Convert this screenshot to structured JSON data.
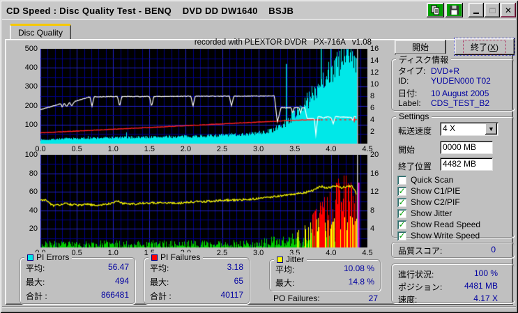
{
  "window": {
    "title": "CD Speed : Disc Quality Test - BENQ    DVD DD DW1640    BSJB"
  },
  "titlebar": {
    "copy": "copy",
    "save": "save",
    "minimize": "minimize",
    "maximize": "maximize",
    "close": "close"
  },
  "tab": {
    "label": "Disc Quality"
  },
  "chart_header": "recorded with PLEXTOR DVDR   PX-716A   v1.08",
  "actions": {
    "start_label": "開始",
    "exit_pre": "終了(",
    "exit_key": "X",
    "exit_post": ")"
  },
  "disc_info": {
    "title": "ディスク情報",
    "rows": [
      {
        "label": "タイプ:",
        "value": "DVD+R"
      },
      {
        "label": "ID:",
        "value": "YUDEN000 T02"
      },
      {
        "label": "日付:",
        "value": "10 August 2005"
      },
      {
        "label": "Label:",
        "value": "CDS_TEST_B2"
      }
    ]
  },
  "settings": {
    "title": "Settings",
    "speed_label": "転送速度",
    "speed_value": "4 X",
    "start_label": "開始",
    "start_value": "0000 MB",
    "end_label": "終了位置",
    "end_value": "4482 MB",
    "checkboxes": [
      {
        "label": "Quick Scan",
        "checked": false
      },
      {
        "label": "Show C1/PIE",
        "checked": true
      },
      {
        "label": "Show C2/PIF",
        "checked": true
      },
      {
        "label": "Show Jitter",
        "checked": true
      },
      {
        "label": "Show Read Speed",
        "checked": true
      },
      {
        "label": "Show Write Speed",
        "checked": true
      }
    ]
  },
  "score": {
    "label": "品質スコア:",
    "value": "0"
  },
  "progress": {
    "rows": [
      {
        "label": "進行状況:",
        "value": "100 %"
      },
      {
        "label": "ポジション:",
        "value": "4481 MB"
      },
      {
        "label": "速度:",
        "value": "4.17 X"
      }
    ]
  },
  "stats": {
    "pi_errors": {
      "title": "PI Errors",
      "color": "#00e8e8",
      "rows": [
        {
          "label": "平均:",
          "value": "56.47"
        },
        {
          "label": "最大:",
          "value": "494"
        },
        {
          "label": "合計 :",
          "value": "866481"
        }
      ]
    },
    "pi_failures": {
      "title": "PI Failures",
      "color": "#ff0000",
      "rows": [
        {
          "label": "平均:",
          "value": "3.18"
        },
        {
          "label": "最大:",
          "value": "65"
        },
        {
          "label": "合計 :",
          "value": "40117"
        }
      ]
    },
    "jitter": {
      "title": "Jitter",
      "color": "#ffff00",
      "rows": [
        {
          "label": "平均:",
          "value": "10.08 %"
        },
        {
          "label": "最大:",
          "value": "14.8 %"
        }
      ]
    },
    "po_failures": {
      "label": "PO Failures:",
      "value": "27"
    }
  },
  "colors": {
    "value_text": "#0000a0",
    "plot_bg": "#000000",
    "grid_minor": "#000088",
    "grid_major": "#2222c8"
  },
  "chart_data": [
    {
      "type": "area",
      "title": "PI Errors / speed scan",
      "x_range": [
        0,
        4.5
      ],
      "x_ticks": [
        0,
        0.5,
        1,
        1.5,
        2,
        2.5,
        3,
        3.5,
        4,
        4.5
      ],
      "left_axis": {
        "range": [
          0,
          500
        ],
        "ticks": [
          100,
          200,
          300,
          400,
          500
        ],
        "grid_step": 50
      },
      "right_axis": {
        "range": [
          0,
          16
        ],
        "ticks": [
          2,
          4,
          6,
          8,
          10,
          12,
          14,
          16
        ]
      },
      "data_end_x": 4.35,
      "grid": {
        "x_minor": 0.1,
        "x_major": 0.5
      },
      "series": [
        {
          "name": "PI Errors",
          "style": "area",
          "axis": "left",
          "color": "#00e8e8",
          "seed": 7,
          "noise": 0.2,
          "points": [
            [
              0,
              20
            ],
            [
              0.3,
              26
            ],
            [
              0.6,
              28
            ],
            [
              1,
              32
            ],
            [
              1.4,
              34
            ],
            [
              1.8,
              36
            ],
            [
              2.2,
              40
            ],
            [
              2.5,
              44
            ],
            [
              2.7,
              48
            ],
            [
              2.9,
              52
            ],
            [
              3,
              56
            ],
            [
              3.1,
              62
            ],
            [
              3.2,
              72
            ],
            [
              3.3,
              90
            ],
            [
              3.4,
              120
            ],
            [
              3.5,
              160
            ],
            [
              3.6,
              195
            ],
            [
              3.7,
              240
            ],
            [
              3.8,
              295
            ],
            [
              3.9,
              345
            ],
            [
              4,
              390
            ],
            [
              4.1,
              420
            ],
            [
              4.2,
              455
            ],
            [
              4.25,
              470
            ],
            [
              4.3,
              465
            ],
            [
              4.35,
              430
            ]
          ],
          "spikes": [
            [
              3.38,
              420
            ],
            [
              3.86,
              500
            ]
          ]
        },
        {
          "name": "Write Speed",
          "style": "line",
          "axis": "right",
          "color": "#ff2020",
          "width": 1.4,
          "seed": 11,
          "noise": 0.04,
          "dash_from": 3.85,
          "marker": [
            4.32,
            4.05
          ],
          "points": [
            [
              0,
              1.82
            ],
            [
              0.5,
              2.12
            ],
            [
              1,
              2.42
            ],
            [
              1.5,
              2.72
            ],
            [
              2,
              3.02
            ],
            [
              2.5,
              3.33
            ],
            [
              3,
              3.63
            ],
            [
              3.3,
              3.82
            ],
            [
              3.6,
              4.0
            ],
            [
              4.35,
              4.05
            ]
          ]
        },
        {
          "name": "Read Speed",
          "style": "line",
          "axis": "right",
          "color": "#ffffff",
          "width": 1.2,
          "seed": 5,
          "noise": 0.05,
          "points": [
            [
              0,
              5.75
            ],
            [
              0.12,
              6.15
            ],
            [
              0.2,
              6.45
            ],
            [
              0.28,
              6.75
            ],
            [
              0.3,
              6.15
            ],
            [
              0.33,
              6.85
            ],
            [
              0.36,
              6.2
            ],
            [
              0.4,
              6.95
            ],
            [
              0.43,
              6.35
            ],
            [
              0.47,
              7.1
            ],
            [
              0.6,
              7.6
            ],
            [
              0.68,
              7.9
            ],
            [
              0.71,
              6.3
            ],
            [
              0.74,
              7.9
            ],
            [
              1.06,
              7.95
            ],
            [
              1.09,
              6.3
            ],
            [
              1.12,
              7.95
            ],
            [
              1.5,
              7.95
            ],
            [
              1.53,
              6.25
            ],
            [
              1.56,
              7.95
            ],
            [
              2.07,
              8
            ],
            [
              2.1,
              6.3
            ],
            [
              2.13,
              8
            ],
            [
              2.6,
              8
            ],
            [
              2.63,
              6.3
            ],
            [
              2.66,
              8
            ],
            [
              3.22,
              8.05
            ],
            [
              3.26,
              3.6
            ],
            [
              3.31,
              6.05
            ],
            [
              3.45,
              6.05
            ],
            [
              3.47,
              5.05
            ],
            [
              3.49,
              6.05
            ],
            [
              3.56,
              6.05
            ],
            [
              3.58,
              5.1
            ],
            [
              3.6,
              6.05
            ],
            [
              3.64,
              6.05
            ],
            [
              3.67,
              4.2
            ],
            [
              3.72,
              4.25
            ],
            [
              3.77,
              4.2
            ],
            [
              3.79,
              1.45
            ],
            [
              3.82,
              4.6
            ],
            [
              3.9,
              4.35
            ],
            [
              3.96,
              4.55
            ],
            [
              4,
              4.4
            ],
            [
              4.03,
              3.35
            ],
            [
              4.06,
              4.6
            ],
            [
              4.12,
              4.45
            ],
            [
              4.2,
              4.5
            ],
            [
              4.28,
              4.4
            ],
            [
              4.3,
              3.9
            ],
            [
              4.32,
              4.6
            ],
            [
              4.35,
              4.4
            ]
          ]
        }
      ],
      "markers": [
        {
          "x": 4.36,
          "color": "#b8b8b8",
          "from_frac": 0
        }
      ]
    },
    {
      "type": "bar",
      "title": "PI Failures / Jitter scan",
      "x_range": [
        0,
        4.5
      ],
      "x_ticks": [
        0,
        0.5,
        1,
        1.5,
        2,
        2.5,
        3,
        3.5,
        4,
        4.5
      ],
      "left_axis": {
        "range": [
          0,
          100
        ],
        "ticks": [
          20,
          40,
          60,
          80,
          100
        ],
        "grid_step": 10
      },
      "right_axis": {
        "range": [
          0,
          20
        ],
        "ticks": [
          4,
          8,
          12,
          16,
          20
        ]
      },
      "data_end_x": 4.35,
      "grid": {
        "x_minor": 0.1,
        "x_major": 0.5
      },
      "series": [
        {
          "name": "PI Failures",
          "style": "bars",
          "axis": "left",
          "seed": 23,
          "envelope": [
            [
              0,
              7
            ],
            [
              0.5,
              7
            ],
            [
              1,
              8
            ],
            [
              1.5,
              8
            ],
            [
              2,
              8
            ],
            [
              2.5,
              8
            ],
            [
              3,
              9
            ],
            [
              3.2,
              12
            ],
            [
              3.4,
              16
            ],
            [
              3.55,
              22
            ],
            [
              3.7,
              30
            ],
            [
              3.8,
              45
            ],
            [
              3.9,
              55
            ],
            [
              4,
              65
            ],
            [
              4.1,
              75
            ],
            [
              4.2,
              88
            ],
            [
              4.3,
              90
            ],
            [
              4.35,
              85
            ]
          ],
          "colors": {
            "green": "#00cc00",
            "yellow": "#ffff00",
            "red": "#ff0000"
          },
          "thresholds": {
            "green_max": 16,
            "yellow_max": 35
          }
        },
        {
          "name": "Jitter",
          "style": "line",
          "axis": "right",
          "color": "#ffff00",
          "width": 1.2,
          "seed": 31,
          "noise": 0.22,
          "points": [
            [
              0,
              10.1
            ],
            [
              0.05,
              10.35
            ],
            [
              0.1,
              9.9
            ],
            [
              0.18,
              8.95
            ],
            [
              0.25,
              9.2
            ],
            [
              0.35,
              9.45
            ],
            [
              0.45,
              9.25
            ],
            [
              0.55,
              9.05
            ],
            [
              0.65,
              9.35
            ],
            [
              0.75,
              9.05
            ],
            [
              0.85,
              9.2
            ],
            [
              0.95,
              9.45
            ],
            [
              1.05,
              10.05
            ],
            [
              1.12,
              9.55
            ],
            [
              1.3,
              9.4
            ],
            [
              1.5,
              9.6
            ],
            [
              1.7,
              9.7
            ],
            [
              1.9,
              9.55
            ],
            [
              2.1,
              9.85
            ],
            [
              2.3,
              9.95
            ],
            [
              2.5,
              10.15
            ],
            [
              2.7,
              10.25
            ],
            [
              2.9,
              10.4
            ],
            [
              3.05,
              10.7
            ],
            [
              3.2,
              10.95
            ],
            [
              3.35,
              11.2
            ],
            [
              3.5,
              11.55
            ],
            [
              3.65,
              11.9
            ],
            [
              3.75,
              12.35
            ],
            [
              3.82,
              12.95
            ],
            [
              3.87,
              13.15
            ],
            [
              3.92,
              12.75
            ],
            [
              4,
              13.0
            ],
            [
              4.08,
              13.4
            ],
            [
              4.14,
              12.9
            ],
            [
              4.2,
              13.1
            ],
            [
              4.28,
              13.3
            ],
            [
              4.32,
              12.6
            ],
            [
              4.35,
              11.4
            ]
          ]
        }
      ],
      "markers": [
        {
          "x": 4.36,
          "color": "#c0c0c0",
          "from_frac": 0
        },
        {
          "x": 4.38,
          "color": "#ff00ff",
          "from_frac": 0.3
        }
      ]
    }
  ]
}
